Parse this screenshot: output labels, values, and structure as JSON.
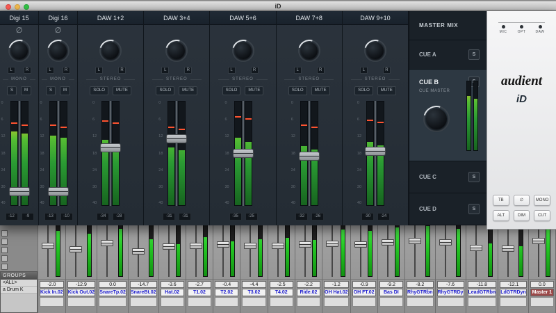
{
  "theme": {
    "meter_green": "#2fae3c",
    "peak_red": "#ff5330",
    "pt_name_blue": "#1a1ace",
    "master_strip_red": "#9c4a4a",
    "id_background": "#262e36",
    "selected_cue_background": "#2d3842"
  },
  "titlebar": {
    "title": "iD"
  },
  "id_mixer": {
    "db_scale": [
      "0",
      "6",
      "12",
      "18",
      "24",
      "30",
      "40"
    ],
    "channels": [
      {
        "name": "Digi 15",
        "mono": true,
        "mode": "MONO",
        "solo": "S",
        "mute": "M",
        "phase": "∅",
        "lr": [
          "L",
          "R"
        ],
        "fader": 0.9,
        "meter": [
          0.7,
          0.68
        ],
        "peak": 0.2,
        "readout": [
          "-12",
          "-9"
        ]
      },
      {
        "name": "Digi 16",
        "mono": true,
        "mode": "MONO",
        "solo": "S",
        "mute": "M",
        "phase": "∅",
        "lr": [
          "L",
          "R"
        ],
        "fader": 0.9,
        "meter": [
          0.66,
          0.64
        ],
        "peak": 0.22,
        "readout": [
          "-13",
          "-10"
        ]
      },
      {
        "name": "DAW 1+2",
        "mono": false,
        "mode": "STEREO",
        "solo": "SOLO",
        "mute": "MUTE",
        "phase": "",
        "lr": [
          "L",
          "R"
        ],
        "fader": 0.44,
        "meter": [
          0.62,
          0.58
        ],
        "peak": 0.18,
        "readout": [
          "-34",
          "-28"
        ]
      },
      {
        "name": "DAW 3+4",
        "mono": false,
        "mode": "STEREO",
        "solo": "SOLO",
        "mute": "MUTE",
        "phase": "",
        "lr": [
          "L",
          "R"
        ],
        "fader": 0.35,
        "meter": [
          0.55,
          0.52
        ],
        "peak": 0.24,
        "readout": [
          "-31",
          "-31"
        ]
      },
      {
        "name": "DAW 5+6",
        "mono": false,
        "mode": "STEREO",
        "solo": "SOLO",
        "mute": "MUTE",
        "phase": "",
        "lr": [
          "L",
          "R"
        ],
        "fader": 0.5,
        "meter": [
          0.64,
          0.6
        ],
        "peak": 0.14,
        "readout": [
          "-35",
          "-25"
        ]
      },
      {
        "name": "DAW 7+8",
        "mono": false,
        "mode": "STEREO",
        "solo": "SOLO",
        "mute": "MUTE",
        "phase": "",
        "lr": [
          "L",
          "R"
        ],
        "fader": 0.53,
        "meter": [
          0.56,
          0.53
        ],
        "peak": 0.22,
        "readout": [
          "-32",
          "-26"
        ]
      },
      {
        "name": "DAW 9+10",
        "mono": false,
        "mode": "STEREO",
        "solo": "SOLO",
        "mute": "MUTE",
        "phase": "",
        "lr": [
          "L",
          "R"
        ],
        "fader": 0.48,
        "meter": [
          0.6,
          0.57
        ],
        "peak": 0.17,
        "readout": [
          "-30",
          "-24"
        ]
      }
    ]
  },
  "sidebar": {
    "master": "MASTER MIX",
    "cues": [
      {
        "label": "CUE A",
        "solo": "S",
        "selected": false
      },
      {
        "label": "CUE B",
        "solo": "S",
        "selected": true,
        "sub": "CUE MASTER",
        "meter": [
          0.78,
          0.74
        ]
      },
      {
        "label": "CUE C",
        "solo": "S",
        "selected": false
      },
      {
        "label": "CUE D",
        "solo": "S",
        "selected": false
      }
    ]
  },
  "monitor_panel": {
    "indicators": [
      "MIC",
      "OPT",
      "DAW"
    ],
    "logo": "audient",
    "logo_sub": "iD",
    "buttons": [
      "TB",
      "∅",
      "MONO",
      "ALT",
      "DIM",
      "CUT"
    ]
  },
  "pro_tools": {
    "groups": {
      "title": "GROUPS",
      "items": [
        "<ALL>",
        "a Drum K"
      ]
    },
    "tracks": [
      {
        "value": "-2.0",
        "name": "Kick In.02",
        "fader": 0.4,
        "meter": 0.85,
        "master": false
      },
      {
        "value": "-12.9",
        "name": "Kick Out.02",
        "fader": 0.48,
        "meter": 0.8,
        "master": false
      },
      {
        "value": "0.0",
        "name": "SnareTp.02",
        "fader": 0.35,
        "meter": 0.9,
        "master": false
      },
      {
        "value": "-14.7",
        "name": "SnareBt.02",
        "fader": 0.52,
        "meter": 0.7,
        "master": false
      },
      {
        "value": "-3.6",
        "name": "Hat.02",
        "fader": 0.42,
        "meter": 0.6,
        "master": false
      },
      {
        "value": "-2.7",
        "name": "T1.02",
        "fader": 0.4,
        "meter": 0.74,
        "master": false
      },
      {
        "value": "-0.4",
        "name": "T2.02",
        "fader": 0.38,
        "meter": 0.66,
        "master": false
      },
      {
        "value": "-4.4",
        "name": "T3.02",
        "fader": 0.41,
        "meter": 0.7,
        "master": false
      },
      {
        "value": "-2.5",
        "name": "T4.02",
        "fader": 0.4,
        "meter": 0.72,
        "master": false
      },
      {
        "value": "-2.2",
        "name": "Ride.02",
        "fader": 0.37,
        "meter": 0.68,
        "master": false
      },
      {
        "value": "-1.2",
        "name": "OH Hat.02",
        "fader": 0.36,
        "meter": 0.88,
        "master": false
      },
      {
        "value": "-0.9",
        "name": "OH FT.02",
        "fader": 0.38,
        "meter": 0.86,
        "master": false
      },
      {
        "value": "-9.2",
        "name": "Bas DI",
        "fader": 0.33,
        "meter": 0.92,
        "master": false
      },
      {
        "value": "-8.2",
        "name": "RhyGTRbn",
        "fader": 0.31,
        "meter": 0.95,
        "master": false
      },
      {
        "value": "-7.6",
        "name": "RhyGTRDy",
        "fader": 0.34,
        "meter": 0.9,
        "master": false
      },
      {
        "value": "-11.8",
        "name": "LeadGTRbn",
        "fader": 0.45,
        "meter": 0.62,
        "master": false
      },
      {
        "value": "-12.1",
        "name": "LdGTRDyn",
        "fader": 0.47,
        "meter": 0.56,
        "master": false
      },
      {
        "value": "0.0",
        "name": "Master 1",
        "fader": 0.3,
        "meter": 0.96,
        "master": true
      }
    ]
  }
}
